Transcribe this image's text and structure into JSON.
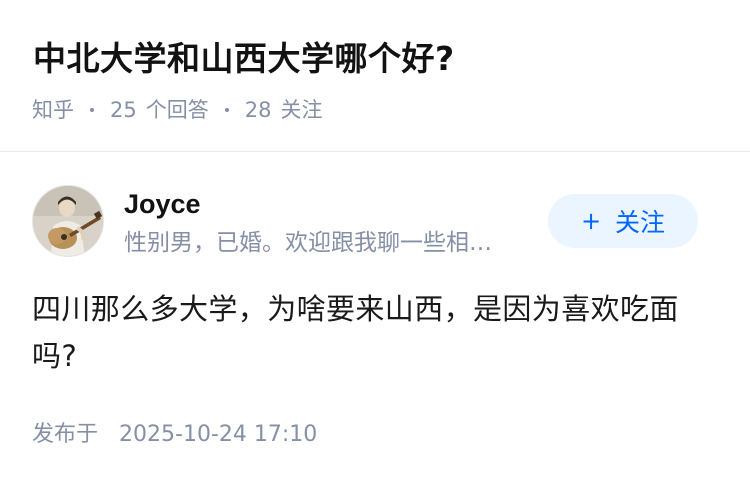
{
  "question": {
    "title": "中北大学和山西大学哪个好?",
    "source": "知乎",
    "answer_count": "25",
    "answer_label": "个回答",
    "follow_count": "28",
    "follow_label": "关注"
  },
  "author": {
    "name": "Joyce",
    "bio": "性别男，已婚。欢迎跟我聊一些相…",
    "avatar_icon": "avatar-guitar-photo",
    "follow_button_icon": "plus-icon",
    "follow_button_label": "关注"
  },
  "answer": {
    "text": "四川那么多大学，为啥要来山西，是因为喜欢吃面吗?"
  },
  "publish": {
    "label": "发布于",
    "datetime": "2025-10-24 17:10"
  },
  "colors": {
    "title": "#121212",
    "meta": "#8590a6",
    "accent": "#0066ff",
    "button_bg": "#ebf5ff"
  }
}
